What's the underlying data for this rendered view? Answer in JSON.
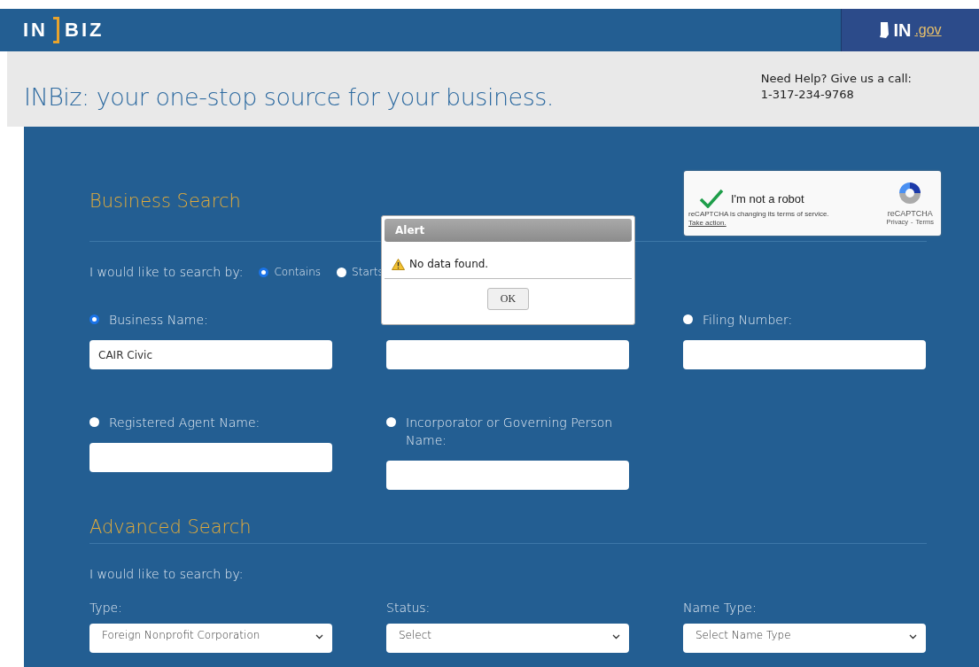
{
  "header": {
    "logo_left": "IN",
    "logo_right": "BIZ",
    "gov_logo": "IN",
    "gov_suffix": ".gov"
  },
  "banner": {
    "tagline": "INBiz: your one-stop source for your business.",
    "help_text": "Need Help? Give us a call:",
    "phone": "1-317-234-9768"
  },
  "business_search": {
    "title": "Business Search",
    "search_by_label": "I would like to search by:",
    "match_modes": [
      {
        "label": "Contains",
        "selected": true
      },
      {
        "label": "Starts",
        "selected": false
      }
    ],
    "fields": [
      {
        "kind": "radio",
        "label": "Business Name:",
        "selected": true,
        "value": "CAIR Civic"
      },
      {
        "kind": "plain"
      },
      {
        "kind": "radio",
        "label": "Filing Number:",
        "selected": false
      },
      {
        "kind": "radio",
        "label": "Registered Agent Name:",
        "selected": false
      },
      {
        "kind": "radio",
        "label": "Incorporator or Governing Person Name:",
        "selected": false
      }
    ]
  },
  "captcha": {
    "label": "I'm not a robot",
    "checked": true,
    "notice": "reCAPTCHA is changing its terms of service.",
    "action_link": "Take action.",
    "brand": "reCAPTCHA",
    "privacy_link": "Privacy",
    "separator": "-",
    "terms_link": "Terms"
  },
  "advanced_search": {
    "title": "Advanced Search",
    "search_by_label": "I would like to search by:",
    "dropdowns": [
      {
        "label": "Type:",
        "value": "Foreign Nonprofit Corporation"
      },
      {
        "label": "Status:",
        "value": "Select"
      },
      {
        "label": "Name Type:",
        "value": "Select Name Type"
      }
    ]
  },
  "alert": {
    "title": "Alert",
    "message": "No data found.",
    "button": "OK"
  }
}
